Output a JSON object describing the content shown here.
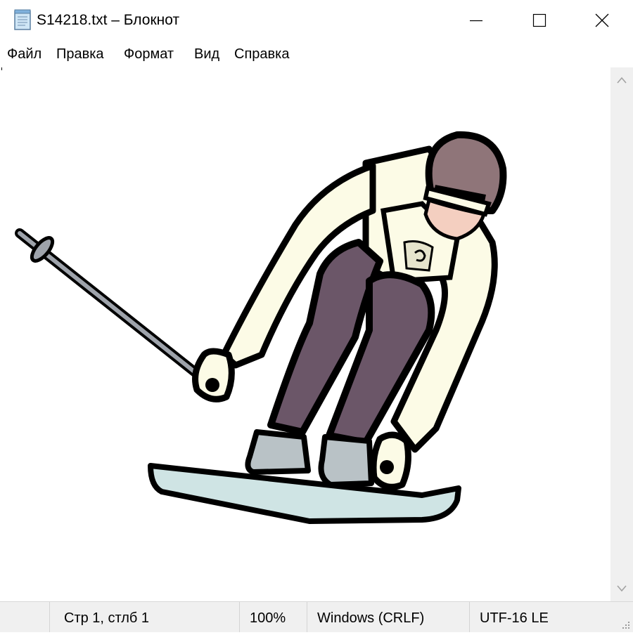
{
  "window": {
    "title": "S14218.txt – Блокнот",
    "icon": "notepad-icon"
  },
  "menu": {
    "items": [
      "Файл",
      "Правка",
      "Формат",
      "Вид",
      "Справка"
    ]
  },
  "editor": {
    "content_image": "skier-ascii-art"
  },
  "status": {
    "position": "Стр 1, стлб 1",
    "zoom": "100%",
    "line_endings": "Windows (CRLF)",
    "encoding": "UTF-16 LE"
  },
  "colors": {
    "outline": "#000000",
    "jacket": "#fcfbe6",
    "pants": "#6b5668",
    "helmet": "#8f7579",
    "ski": "#cfe4e4",
    "boot": "#b9c2c6",
    "face": "#f4cfc0",
    "pole": "#9ea3ab"
  }
}
